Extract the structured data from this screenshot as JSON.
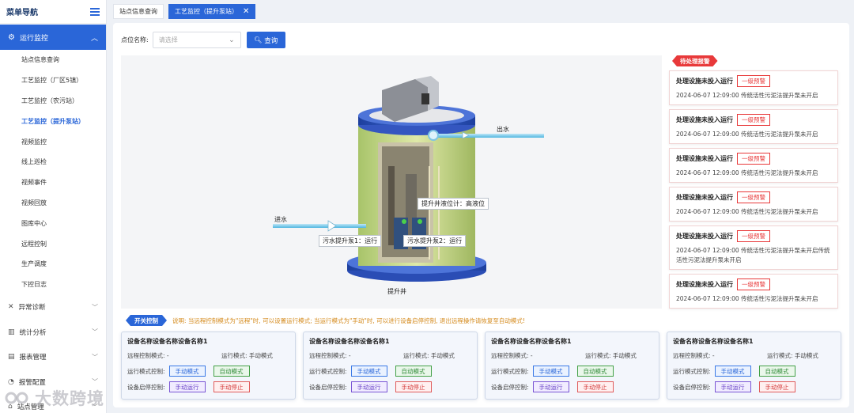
{
  "sidebar": {
    "title": "菜单导航",
    "active_group": "运行监控",
    "sub_items": [
      "站点信息查询",
      "工艺监控（厂区5镇）",
      "工艺监控（农污站）",
      "工艺监控（提升泵站）",
      "视频监控",
      "线上巡检",
      "视频事件",
      "视频回放",
      "图库中心",
      "远程控制",
      "生产调度",
      "下控日志"
    ],
    "active_sub_index": 3,
    "groups": [
      "异常诊断",
      "统计分析",
      "报表管理",
      "报警配置",
      "站点管理"
    ]
  },
  "watermark": "大数跨境",
  "tabs": [
    {
      "label": "站点信息查询"
    },
    {
      "label": "工艺监控（提升泵站）"
    }
  ],
  "filter": {
    "label": "点位名称:",
    "placeholder": "请选择",
    "query_label": "查询"
  },
  "scene": {
    "outlet_label": "出水",
    "inlet_label": "进水",
    "well_label": "提升井",
    "level_callout": "提升井液位计：高液位",
    "pump1_callout": "污水提升泵1：运行",
    "pump2_callout": "污水提升泵2：运行"
  },
  "alarm": {
    "title": "待处理报警",
    "items": [
      {
        "name": "处理设施未投入运行",
        "level": "一级预警",
        "desc": "2024-06-07 12:09:00 传统活性污泥法提升泵未开启"
      },
      {
        "name": "处理设施未投入运行",
        "level": "一级预警",
        "desc": "2024-06-07 12:09:00 传统活性污泥法提升泵未开启"
      },
      {
        "name": "处理设施未投入运行",
        "level": "一级预警",
        "desc": "2024-06-07 12:09:00 传统活性污泥法提升泵未开启"
      },
      {
        "name": "处理设施未投入运行",
        "level": "一级预警",
        "desc": "2024-06-07 12:09:00 传统活性污泥法提升泵未开启"
      },
      {
        "name": "处理设施未投入运行",
        "level": "一级预警",
        "desc": "2024-06-07 12:09:00 传统活性污泥法提升泵未开启传统活性污泥法提升泵未开启"
      },
      {
        "name": "处理设施未投入运行",
        "level": "一级预警",
        "desc": "2024-06-07 12:09:00 传统活性污泥法提升泵未开启"
      }
    ]
  },
  "switch": {
    "tag": "开关控制",
    "desc": "说明: 当远程控制模式为\"远程\"时, 可以设置运行模式; 当运行模式为\"手动\"时, 可以进行设备启停控制, 退出远程操作请恢复至自动模式!"
  },
  "devices": [
    {
      "name": "设备名称设备名称设备名称1",
      "remote_label": "远程控制模式:",
      "remote_value": "-",
      "run_label": "运行模式:",
      "run_value": "手动模式",
      "mode_ctrl_label": "运行模式控制:",
      "manual_mode": "手动模式",
      "auto_mode": "自动模式",
      "start_ctrl_label": "设备启停控制:",
      "manual_run": "手动运行",
      "manual_stop": "手动停止"
    },
    {
      "name": "设备名称设备名称设备名称1",
      "remote_label": "远程控制模式:",
      "remote_value": "-",
      "run_label": "运行模式:",
      "run_value": "手动模式",
      "mode_ctrl_label": "运行模式控制:",
      "manual_mode": "手动模式",
      "auto_mode": "自动模式",
      "start_ctrl_label": "设备启停控制:",
      "manual_run": "手动运行",
      "manual_stop": "手动停止"
    },
    {
      "name": "设备名称设备名称设备名称1",
      "remote_label": "远程控制模式:",
      "remote_value": "-",
      "run_label": "运行模式:",
      "run_value": "手动模式",
      "mode_ctrl_label": "运行模式控制:",
      "manual_mode": "手动模式",
      "auto_mode": "自动模式",
      "start_ctrl_label": "设备启停控制:",
      "manual_run": "手动运行",
      "manual_stop": "手动停止"
    },
    {
      "name": "设备名称设备名称设备名称1",
      "remote_label": "远程控制模式:",
      "remote_value": "-",
      "run_label": "运行模式:",
      "run_value": "手动模式",
      "mode_ctrl_label": "运行模式控制:",
      "manual_mode": "手动模式",
      "auto_mode": "自动模式",
      "start_ctrl_label": "设备启停控制:",
      "manual_run": "手动运行",
      "manual_stop": "手动停止"
    }
  ],
  "colors": {
    "primary": "#2a66d8",
    "alarm": "#e8393a",
    "notice": "#d4891a"
  },
  "icons": [
    "menu-fold-icon",
    "monitor-icon",
    "chevron-up-icon",
    "search-icon",
    "close-icon",
    "chevron-down-icon"
  ]
}
